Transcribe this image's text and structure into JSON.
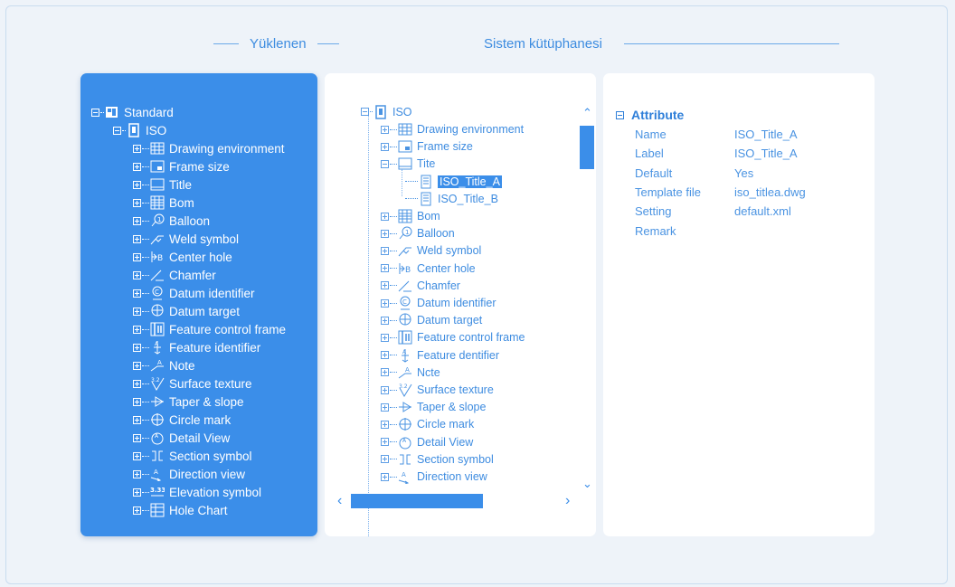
{
  "tabs": {
    "uploaded": "Yüklenen",
    "library": "Sistem kütüphanesi"
  },
  "left_tree": {
    "root": "Standard",
    "child": "ISO",
    "items": [
      {
        "label": "Drawing environment",
        "icon": "grid-icon"
      },
      {
        "label": "Frame size",
        "icon": "frame-icon"
      },
      {
        "label": "Title",
        "icon": "title-icon"
      },
      {
        "label": "Bom",
        "icon": "table-icon"
      },
      {
        "label": "Balloon",
        "icon": "balloon-icon"
      },
      {
        "label": "Weld symbol",
        "icon": "weld-icon"
      },
      {
        "label": "Center hole",
        "icon": "center-hole-icon"
      },
      {
        "label": "Chamfer",
        "icon": "chamfer-icon"
      },
      {
        "label": "Datum identifier",
        "icon": "datum-identifier-icon"
      },
      {
        "label": "Datum target",
        "icon": "datum-target-icon"
      },
      {
        "label": "Feature control frame",
        "icon": "feature-control-icon"
      },
      {
        "label": "Feature identifier",
        "icon": "feature-identifier-icon"
      },
      {
        "label": "Note",
        "icon": "note-icon"
      },
      {
        "label": "Surface texture",
        "icon": "surface-texture-icon"
      },
      {
        "label": "Taper & slope",
        "icon": "taper-icon"
      },
      {
        "label": "Circle mark",
        "icon": "circle-mark-icon"
      },
      {
        "label": "Detail View",
        "icon": "detail-view-icon"
      },
      {
        "label": "Section symbol",
        "icon": "section-icon"
      },
      {
        "label": "Direction view",
        "icon": "direction-icon"
      },
      {
        "label": "Elevation symbol",
        "icon": "elevation-icon"
      },
      {
        "label": "Hole Chart",
        "icon": "hole-chart-icon"
      }
    ]
  },
  "mid_tree": {
    "root": "ISO",
    "before": [
      {
        "label": "Drawing environment",
        "icon": "grid-icon"
      },
      {
        "label": "Frame size",
        "icon": "frame-icon"
      }
    ],
    "expanded": {
      "label": "Tite",
      "icon": "title-icon"
    },
    "children": [
      {
        "label": "ISO_Title_A",
        "selected": true
      },
      {
        "label": "ISO_Title_B",
        "selected": false
      }
    ],
    "after": [
      {
        "label": "Bom",
        "icon": "table-icon"
      },
      {
        "label": "Balloon",
        "icon": "balloon-icon"
      },
      {
        "label": "Weld symbol",
        "icon": "weld-icon"
      },
      {
        "label": "Center hole",
        "icon": "center-hole-icon"
      },
      {
        "label": "Chamfer",
        "icon": "chamfer-icon"
      },
      {
        "label": "Datum identifier",
        "icon": "datum-identifier-icon"
      },
      {
        "label": "Datum target",
        "icon": "datum-target-icon"
      },
      {
        "label": "Feature control frame",
        "icon": "feature-control-icon"
      },
      {
        "label": "Feature dentifier",
        "icon": "feature-identifier-icon"
      },
      {
        "label": "Ncte",
        "icon": "note-icon"
      },
      {
        "label": "Surface texture",
        "icon": "surface-texture-icon"
      },
      {
        "label": "Taper & slope",
        "icon": "taper-icon"
      },
      {
        "label": "Circle mark",
        "icon": "circle-mark-icon"
      },
      {
        "label": "Detail View",
        "icon": "detail-view-icon"
      },
      {
        "label": "Section symbol",
        "icon": "section-icon"
      },
      {
        "label": "Direction view",
        "icon": "direction-icon"
      }
    ]
  },
  "attributes": {
    "title": "Attribute",
    "rows": [
      {
        "key": "Name",
        "value": "ISO_Title_A"
      },
      {
        "key": "Label",
        "value": "ISO_Title_A"
      },
      {
        "key": "Default",
        "value": "Yes"
      },
      {
        "key": "Template file",
        "value": "iso_titlea.dwg"
      },
      {
        "key": "Setting",
        "value": "default.xml"
      },
      {
        "key": "Remark",
        "value": ""
      }
    ]
  },
  "colors": {
    "accent": "#3b8ee9",
    "background": "#eef3f9"
  }
}
